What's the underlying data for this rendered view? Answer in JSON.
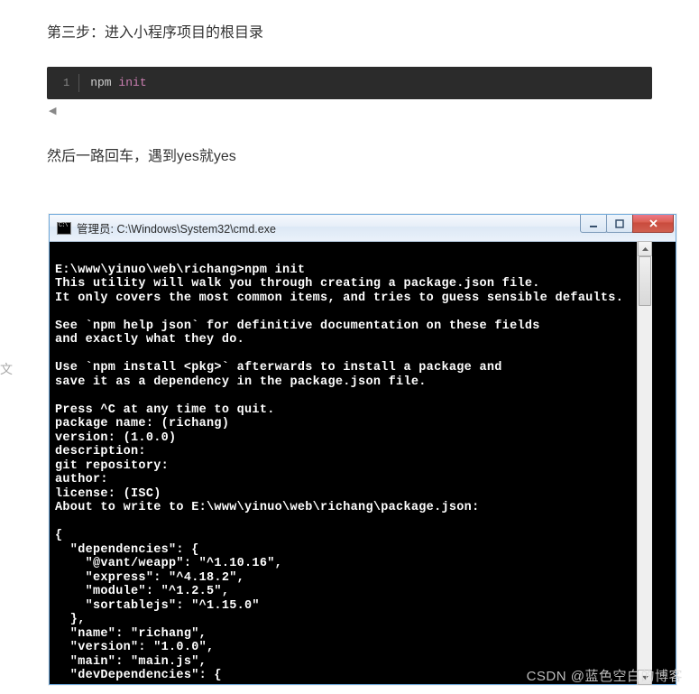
{
  "step_heading": "第三步：进入小程序项目的根目录",
  "code_block": {
    "gutter": "1",
    "cmd": "npm",
    "arg": "init"
  },
  "scroll_left_glyph": "◀",
  "paragraph": "然后一路回车，遇到yes就yes",
  "cmd_window": {
    "title": "管理员: C:\\Windows\\System32\\cmd.exe",
    "terminal_text": "\nE:\\www\\yinuo\\web\\richang>npm init\nThis utility will walk you through creating a package.json file.\nIt only covers the most common items, and tries to guess sensible defaults.\n\nSee `npm help json` for definitive documentation on these fields\nand exactly what they do.\n\nUse `npm install <pkg>` afterwards to install a package and\nsave it as a dependency in the package.json file.\n\nPress ^C at any time to quit.\npackage name: (richang)\nversion: (1.0.0)\ndescription:\ngit repository:\nauthor:\nlicense: (ISC)\nAbout to write to E:\\www\\yinuo\\web\\richang\\package.json:\n\n{\n  \"dependencies\": {\n    \"@vant/weapp\": \"^1.10.16\",\n    \"express\": \"^4.18.2\",\n    \"module\": \"^1.2.5\",\n    \"sortablejs\": \"^1.15.0\"\n  },\n  \"name\": \"richang\",\n  \"version\": \"1.0.0\",\n  \"main\": \"main.js\",\n  \"devDependencies\": {"
  },
  "watermark": "CSDN @蓝色空白的博客",
  "left_ghost": "文"
}
